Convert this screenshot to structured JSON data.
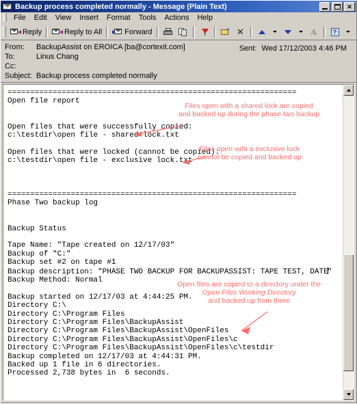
{
  "window": {
    "title": "Backup process completed normally - Message (Plain Text)",
    "icon": "envelope-icon",
    "minimize_label": "Minimize",
    "maximize_label": "Maximize",
    "close_label": "Close"
  },
  "menu": {
    "items": [
      {
        "label": "File",
        "accel": "F"
      },
      {
        "label": "Edit",
        "accel": "E"
      },
      {
        "label": "View",
        "accel": "V"
      },
      {
        "label": "Insert",
        "accel": "I"
      },
      {
        "label": "Format",
        "accel": "o"
      },
      {
        "label": "Tools",
        "accel": "T"
      },
      {
        "label": "Actions",
        "accel": "A"
      },
      {
        "label": "Help",
        "accel": "H"
      }
    ]
  },
  "toolbar": {
    "reply_label": "Reply",
    "reply_all_label": "Reply to All",
    "forward_label": "Forward",
    "print_label": "Print",
    "copy_label": "Copy",
    "flag_label": "Follow Up",
    "move_label": "Move to Folder",
    "delete_label": "Delete",
    "previous_label": "Previous Item",
    "next_label": "Next Item",
    "font_label": "Font",
    "help_label": "Help",
    "help_glyph": "?",
    "delete_glyph": "✕",
    "star_glyph": "✦"
  },
  "header": {
    "from_label": "From:",
    "from_value": "BackupAssist on EROICA [ba@cortexit.com]",
    "to_label": "To:",
    "to_value": "Linus Chang",
    "cc_label": "Cc:",
    "cc_value": "",
    "subject_label": "Subject:",
    "subject_value": "Backup process completed normally",
    "sent_label": "Sent:",
    "sent_value": "Wed 17/12/2003 4:46 PM"
  },
  "body": {
    "part1": "================================================================\nOpen file report\n\n\nOpen files that were successfully copied:\nc:\\testdir\\open file - shared lock.txt\n\nOpen files that were locked (cannot be copied):\nc:\\testdir\\open file - exclusive lock.txt\n\n\n\n================================================================\nPhase Two backup log\n\n\nBackup Status\n\nTape Name: \"Tape created on 12/17/03\"\nBackup of \"C:\"\nBackup set #2 on tape #1\nBackup description: \"PHASE TWO BACKUP FOR BACKUPASSIST: TAPE TEST, DATE",
    "part2": "\"\nBackup Method: Normal\n\nBackup started on 12/17/03 at 4:44:25 PM.\nDirectory C:\\\nDirectory C:\\Program Files\nDirectory C:\\Program Files\\BackupAssist\nDirectory C:\\Program Files\\BackupAssist\\OpenFiles\nDirectory C:\\Program Files\\BackupAssist\\OpenFiles\\c\nDirectory C:\\Program Files\\BackupAssist\\OpenFiles\\c\\testdir\nBackup completed on 12/17/03 at 4:44:31 PM.\nBacked up 1 file in 6 directories.\nProcessed 2,738 bytes in  6 seconds.",
    "caret_present": true
  },
  "annotations": {
    "accent_color": "#ff6b6b",
    "items": [
      {
        "id": "shared-lock-note",
        "line1": "Files open with a shared lock are copied",
        "line2": "and backed up during the phase two backup",
        "line3": ""
      },
      {
        "id": "exclusive-lock-note",
        "line1": "Files open with a exclusive lock",
        "line2": "cannot be copied and backed up",
        "line3": ""
      },
      {
        "id": "working-directory-note",
        "line1": "Open files are copied to a directory under the",
        "line2": "Open Files Working Directory",
        "line3": "and backed up from there"
      }
    ]
  },
  "scrollbar": {
    "up_label": "Scroll up",
    "down_label": "Scroll down",
    "thumb_label": "Scroll thumb"
  }
}
